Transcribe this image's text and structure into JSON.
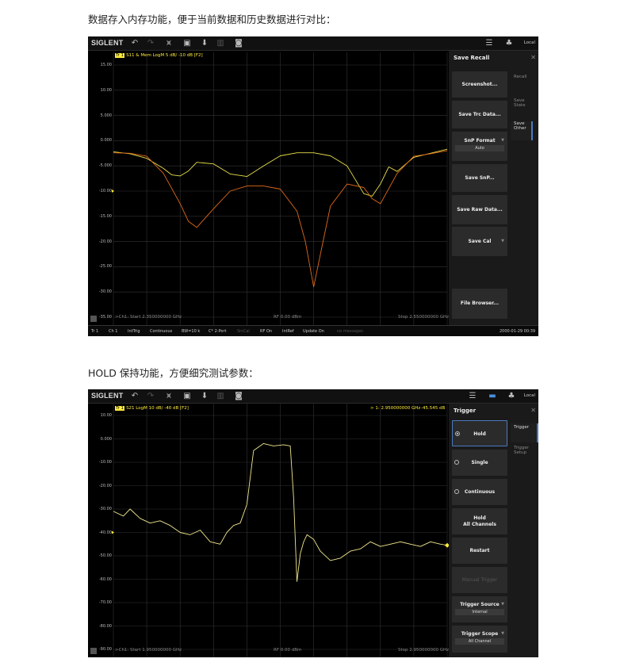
{
  "captions": {
    "first": "数据存入内存功能，便于当前数据和历史数据进行对比：",
    "second": "HOLD 保持功能，方便细究测试参数："
  },
  "screen1": {
    "logo": "SIGLENT",
    "local": "Local",
    "trace_badge": "Tr 1",
    "trace_title": "S11 & Mem LogM 5 dB/ -10 dB [F2]",
    "y_labels": [
      "15.00",
      "10.00",
      "5.000",
      "0.000",
      "-5.000",
      "-10.00",
      "-15.00",
      "-20.00",
      "-25.00",
      "-30.00",
      "-35.00"
    ],
    "start": ">Ch1: Start 2.350000000 GHz",
    "center": "RF 0.00 dBm",
    "stop": "Stop 2.550000000 GHz",
    "status": [
      "Tr 1",
      "Ch 1",
      "IntTrig",
      "Continuous",
      "BW=10 k",
      "C* 2-Port",
      "SrcCal",
      "RF On",
      "IntRef",
      "Update On",
      "no messages",
      "2000-01-29 00:39"
    ],
    "panel_title": "Save Recall",
    "buttons": {
      "screenshot": "Screenshot...",
      "save_trc": "Save Trc Data...",
      "snp_format": "SnP Format",
      "snp_format_value": "Auto",
      "save_snp": "Save SnP...",
      "save_raw": "Save Raw Data...",
      "save_cal": "Save Cal",
      "file_browser": "File Browser..."
    },
    "tabs": {
      "recall": "Recall",
      "save_state": "Save State",
      "save_other": "Save Other"
    },
    "chart_data": {
      "type": "line",
      "xlim": [
        2.35,
        2.55
      ],
      "ylim": [
        -37.5,
        15
      ],
      "series": [
        {
          "color": "#e8e04a",
          "x": [
            2.35,
            2.36,
            2.37,
            2.38,
            2.385,
            2.39,
            2.395,
            2.4,
            2.41,
            2.42,
            2.43,
            2.44,
            2.45,
            2.46,
            2.47,
            2.48,
            2.49,
            2.5,
            2.505,
            2.51,
            2.515,
            2.52,
            2.53,
            2.54,
            2.55
          ],
          "y": [
            -2.2,
            -2.6,
            -3.5,
            -5.5,
            -6.8,
            -7,
            -6,
            -4.3,
            -4.6,
            -6.6,
            -7.1,
            -5,
            -3,
            -2.4,
            -2.4,
            -3,
            -5,
            -10.5,
            -11,
            -8.6,
            -5.2,
            -6.1,
            -3.3,
            -2.5,
            -1.7
          ]
        },
        {
          "color": "#e06a1a",
          "x": [
            2.35,
            2.36,
            2.37,
            2.38,
            2.39,
            2.395,
            2.4,
            2.41,
            2.42,
            2.43,
            2.44,
            2.45,
            2.46,
            2.465,
            2.47,
            2.475,
            2.48,
            2.49,
            2.5,
            2.505,
            2.51,
            2.52,
            2.53,
            2.54,
            2.55
          ],
          "y": [
            -2.4,
            -2.5,
            -3.1,
            -6.5,
            -12.5,
            -16,
            -17.2,
            -13.5,
            -10,
            -9,
            -9,
            -9.6,
            -14,
            -20,
            -29,
            -21,
            -13,
            -8.6,
            -9.3,
            -11.5,
            -12.5,
            -6.5,
            -3.1,
            -2.6,
            -2
          ]
        }
      ]
    }
  },
  "screen2": {
    "logo": "SIGLENT",
    "local": "Local",
    "trace_badge": "Tr 1",
    "trace_title": "S21 LogM 10 dB/ -40 dB [F2]",
    "marker_freq": "> 1:  2.950000000 GHz",
    "marker_val": "-45.545 dB",
    "y_labels": [
      "10.00",
      "0.000",
      "-10.00",
      "-20.00",
      "-30.00",
      "-40.00",
      "-50.00",
      "-60.00",
      "-70.00",
      "-80.00",
      "-90.00"
    ],
    "start": ">Ch1: Start 1.950000000 GHz",
    "center": "RF 0.00 dBm",
    "stop": "Stop 2.950000000 GHz",
    "panel_title": "Trigger",
    "buttons": {
      "hold": "Hold",
      "single": "Single",
      "continuous": "Continuous",
      "hold_all_1": "Hold",
      "hold_all_2": "All Channels",
      "restart": "Restart",
      "manual": "Manual Trigger",
      "source": "Trigger Source",
      "source_value": "Internal",
      "scope": "Trigger Scope",
      "scope_value": "All Channel"
    },
    "tabs": {
      "trigger": "Trigger",
      "trigger_setup": "Trigger Setup"
    },
    "chart_data": {
      "type": "line",
      "xlim": [
        1.95,
        2.95
      ],
      "ylim": [
        -90,
        10
      ],
      "series": [
        {
          "color": "#f0e68c",
          "x": [
            1.95,
            1.98,
            2.0,
            2.03,
            2.06,
            2.09,
            2.12,
            2.15,
            2.18,
            2.21,
            2.24,
            2.27,
            2.29,
            2.31,
            2.33,
            2.35,
            2.37,
            2.4,
            2.43,
            2.46,
            2.48,
            2.49,
            2.5,
            2.51,
            2.52,
            2.53,
            2.55,
            2.57,
            2.6,
            2.63,
            2.66,
            2.69,
            2.72,
            2.75,
            2.78,
            2.81,
            2.84,
            2.87,
            2.9,
            2.93,
            2.95
          ],
          "y": [
            -31,
            -33,
            -30,
            -34,
            -36,
            -35,
            -37,
            -40,
            -41,
            -39,
            -44,
            -45,
            -40,
            -37,
            -36,
            -28,
            -5,
            -2,
            -3,
            -2.5,
            -3,
            -25,
            -61,
            -49,
            -44,
            -41,
            -43,
            -48,
            -52,
            -51,
            -48,
            -47,
            -44,
            -46,
            -45,
            -44,
            -45,
            -46,
            -44,
            -45,
            -45.5
          ]
        }
      ]
    }
  }
}
